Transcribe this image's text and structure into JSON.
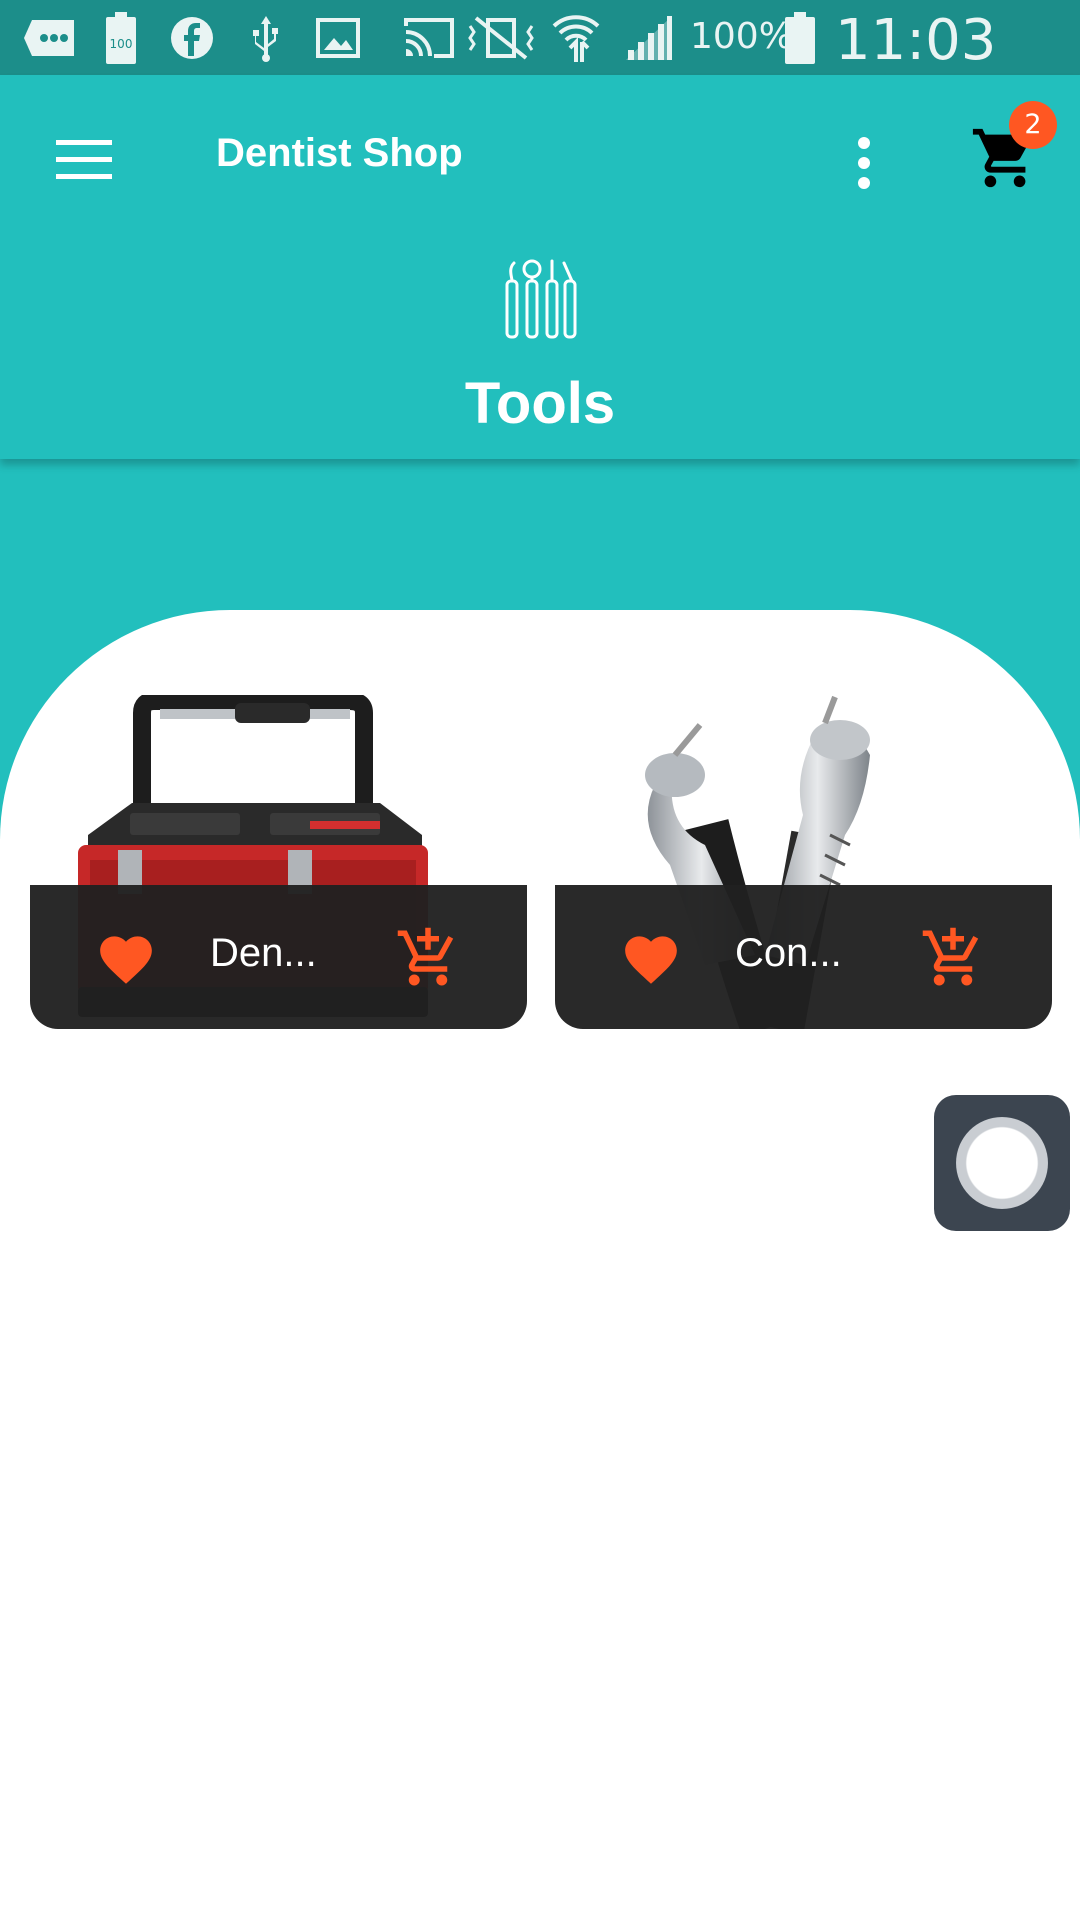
{
  "status_bar": {
    "battery_percent": "100%",
    "time": "11:03 PM",
    "icons": [
      "message-icon",
      "battery-saver-icon",
      "facebook-icon",
      "usb-icon",
      "image-icon",
      "cast-icon",
      "vibrate-off-icon",
      "wifi-icon",
      "signal-icon",
      "battery-icon"
    ]
  },
  "app_bar": {
    "title": "Dentist Shop",
    "menu_icon": "hamburger-menu-icon",
    "more_icon": "more-vertical-icon",
    "cart_icon": "shopping-cart-icon",
    "cart_count": "2",
    "category": {
      "icon": "dental-tools-icon",
      "title": "Tools"
    }
  },
  "products": [
    {
      "name": "Den...",
      "image": "red-black-toolbox-image",
      "favorite_icon": "heart-icon",
      "add_to_cart_icon": "add-to-cart-icon"
    },
    {
      "name": "Con...",
      "image": "dental-handpiece-image",
      "favorite_icon": "heart-icon",
      "add_to_cart_icon": "add-to-cart-icon"
    }
  ],
  "colors": {
    "status_bar": "#1c8e8a",
    "primary": "#22bfbd",
    "accent": "#ff5722",
    "card_footer": "#202020",
    "assistive_button": "#3c4550"
  }
}
